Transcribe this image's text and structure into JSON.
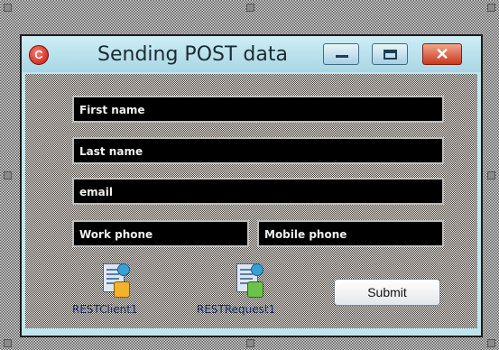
{
  "window": {
    "title": "Sending POST data",
    "close_glyph": "✕",
    "app_icon_letter": "C"
  },
  "form": {
    "first_name": "First name",
    "last_name": "Last name",
    "email": "email",
    "work_phone": "Work phone",
    "mobile_phone": "Mobile phone"
  },
  "components": [
    {
      "label": "RESTClient1",
      "icon": "rest-client-icon"
    },
    {
      "label": "RESTRequest1",
      "icon": "rest-request-icon"
    }
  ],
  "buttons": {
    "submit": "Submit"
  },
  "colors": {
    "titlebar": "#bfe4ee",
    "field_bg": "#000000",
    "close_button": "#c9391d"
  }
}
